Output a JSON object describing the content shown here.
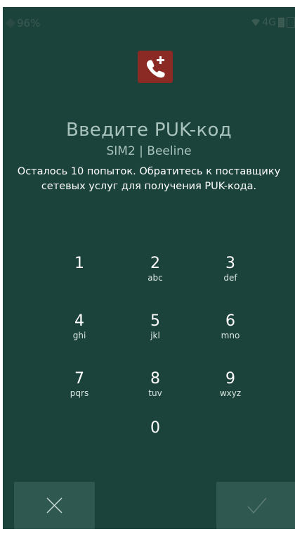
{
  "status_bar": {
    "battery": "96%",
    "network": "4G"
  },
  "header": {
    "title": "Введите PUK-код",
    "subtitle": "SIM2 | Beeline",
    "message": "Осталось 10 попыток. Обратитесь к поставщику сетевых услуг для получения PUK-кода."
  },
  "keypad": [
    {
      "digit": "1",
      "letters": ""
    },
    {
      "digit": "2",
      "letters": "abc"
    },
    {
      "digit": "3",
      "letters": "def"
    },
    {
      "digit": "4",
      "letters": "ghi"
    },
    {
      "digit": "5",
      "letters": "jkl"
    },
    {
      "digit": "6",
      "letters": "mno"
    },
    {
      "digit": "7",
      "letters": "pqrs"
    },
    {
      "digit": "8",
      "letters": "tuv"
    },
    {
      "digit": "9",
      "letters": "wxyz"
    },
    {
      "digit": "0",
      "letters": ""
    }
  ],
  "icons": {
    "sim": "sim-card-phone-icon",
    "cancel": "close-icon",
    "confirm": "check-icon"
  },
  "colors": {
    "background": "#1c433b",
    "sim_icon_bg": "#8b2a25",
    "button_bg": "#2f5850",
    "title_text": "#a8c3bc"
  }
}
